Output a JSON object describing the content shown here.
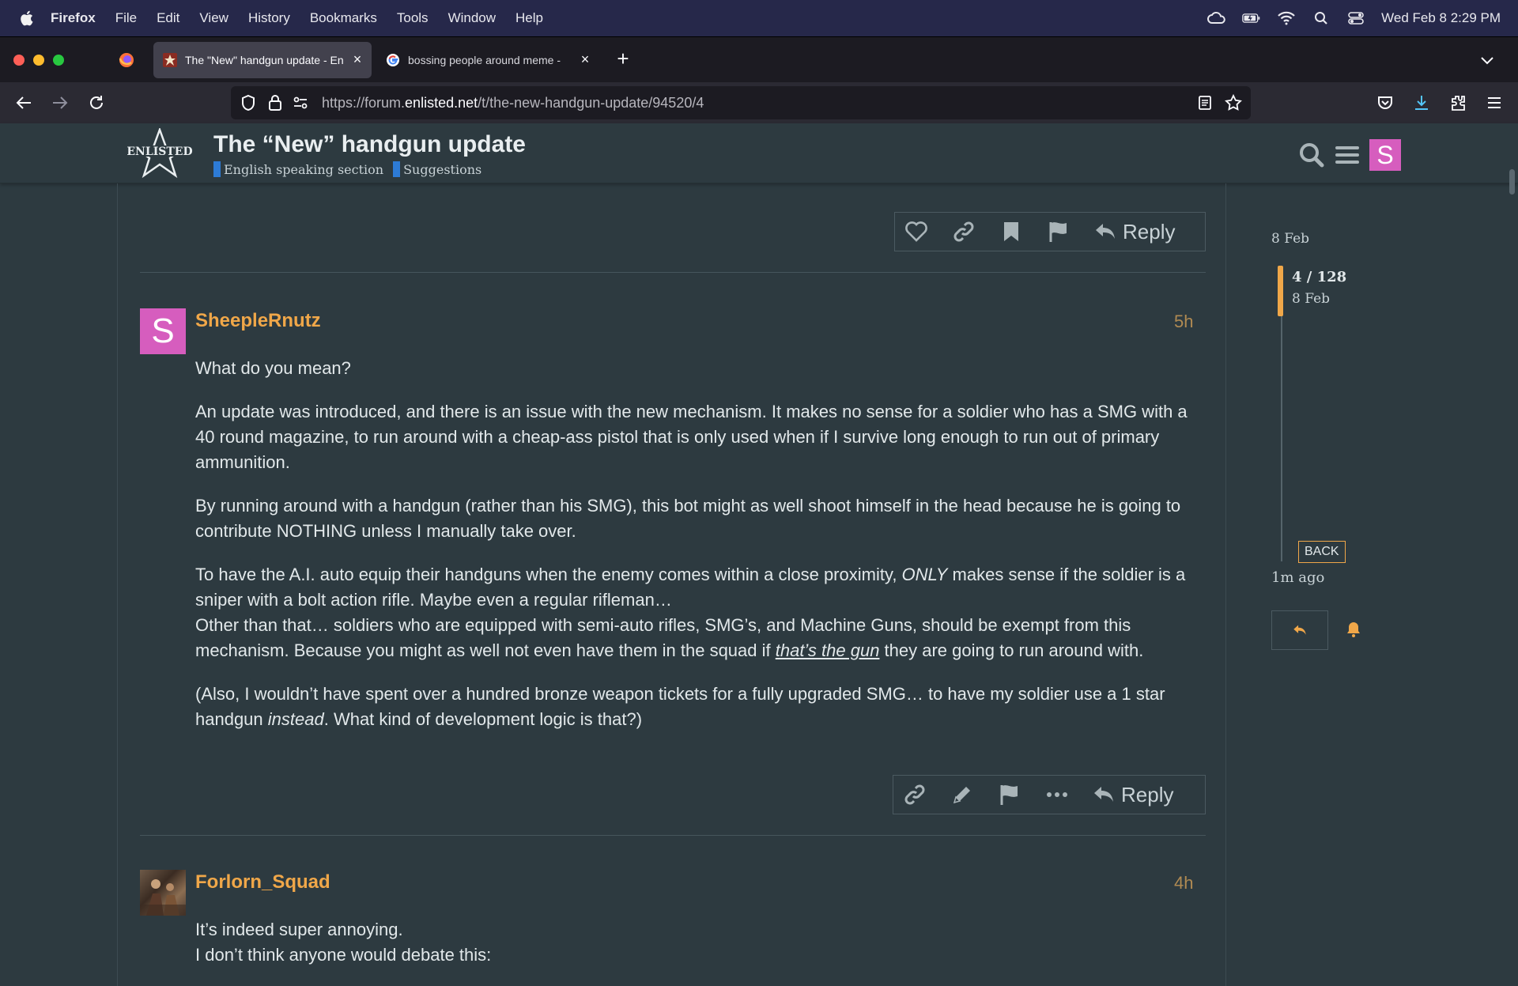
{
  "menubar": {
    "app": "Firefox",
    "items": [
      "File",
      "Edit",
      "View",
      "History",
      "Bookmarks",
      "Tools",
      "Window",
      "Help"
    ],
    "clock": "Wed Feb 8  2:29 PM"
  },
  "tabs": [
    {
      "title": "The \"New\" handgun update - En",
      "active": true
    },
    {
      "title": "bossing people around meme - ",
      "active": false
    }
  ],
  "address": {
    "prefix": "https://forum.",
    "domain": "enlisted.net",
    "path": "/t/the-new-handgun-update/94520/4"
  },
  "forum": {
    "title": "The “New” handgun update",
    "categories": [
      {
        "name": "English speaking section",
        "color": "#2d7bd6"
      },
      {
        "name": "Suggestions",
        "color": "#2d7bd6"
      }
    ],
    "user_initial": "S"
  },
  "colors": {
    "accent": "#f0a749",
    "avatar_pink": "#d65dbe"
  },
  "posts": [
    {
      "username": "SheepleRnutz",
      "avatar_initial": "S",
      "time": "5h",
      "paragraphs": {
        "p1": "What do you mean?",
        "p2": "An update was introduced, and there is an issue with the new mechanism. It makes no sense for a soldier who has a SMG with a 40 round magazine, to run around with a cheap-ass pistol that is only used when if I survive long enough to run out of primary ammunition.",
        "p3": "By running around with a handgun (rather than his SMG), this bot might as well shoot himself in the head because he is going to contribute NOTHING unless I manually take over.",
        "p4a": "To have the A.I. auto equip their handguns when the enemy comes within a close proximity, ",
        "p4_em": "ONLY",
        "p4b": " makes sense if the soldier is a sniper with a bolt action rifle. Maybe even a regular rifleman…",
        "p4c": "Other than that… soldiers who are equipped with semi-auto rifles, SMG’s, and Machine Guns, should be exempt from this mechanism. Because you might as well not even have them in the squad if ",
        "p4_link": "that’s the gun",
        "p4d": " they are going to run around with.",
        "p5a": "(Also, I wouldn’t have spent over a hundred bronze weapon tickets for a fully upgraded SMG… to have my soldier use a 1 star handgun ",
        "p5_em": "instead",
        "p5b": ". What kind of development logic is that?)"
      },
      "reply_label": "Reply"
    },
    {
      "username": "Forlorn_Squad",
      "time": "4h",
      "paragraphs": {
        "p1": "It’s indeed super annoying.",
        "p2": "I don’t think anyone would debate this:"
      }
    }
  ],
  "prev_post_reply_label": "Reply",
  "timeline": {
    "start_date": "8 Feb",
    "position": "4 / 128",
    "position_date": "8 Feb",
    "back_label": "BACK",
    "last_activity": "1m ago"
  }
}
